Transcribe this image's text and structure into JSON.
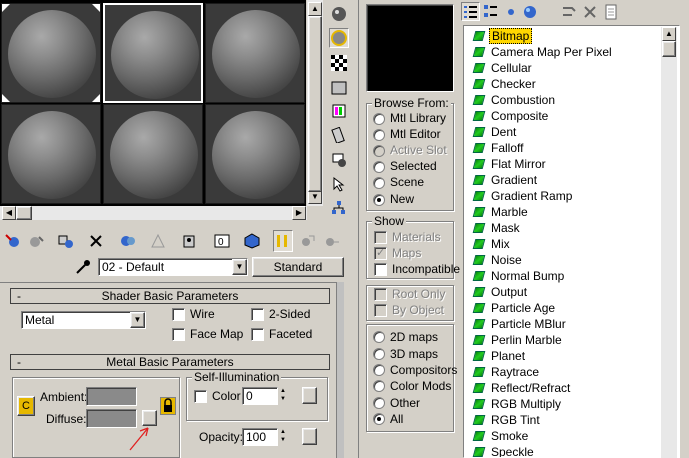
{
  "window": {
    "material_name": "02 - Default",
    "material_type": "Standard"
  },
  "shader_basic": {
    "header": "Shader Basic Parameters",
    "shader_value": "Metal",
    "wire_label": "Wire",
    "two_sided_label": "2-Sided",
    "face_map_label": "Face Map",
    "faceted_label": "Faceted"
  },
  "metal_basic": {
    "header": "Metal Basic Parameters",
    "ambient_label": "Ambient:",
    "diffuse_label": "Diffuse:",
    "self_illum_title": "Self-Illumination",
    "color_label": "Color",
    "color_value": "0",
    "opacity_label": "Opacity:",
    "opacity_value": "100",
    "lock_label": "C"
  },
  "browse_from": {
    "title": "Browse From:",
    "options": [
      {
        "label": "Mtl Library",
        "selected": false,
        "disabled": false
      },
      {
        "label": "Mtl Editor",
        "selected": false,
        "disabled": false
      },
      {
        "label": "Active Slot",
        "selected": false,
        "disabled": true
      },
      {
        "label": "Selected",
        "selected": false,
        "disabled": false
      },
      {
        "label": "Scene",
        "selected": false,
        "disabled": false
      },
      {
        "label": "New",
        "selected": true,
        "disabled": false
      }
    ]
  },
  "show": {
    "title": "Show",
    "options": [
      {
        "label": "Materials",
        "checked": false,
        "disabled": true
      },
      {
        "label": "Maps",
        "checked": true,
        "disabled": true
      },
      {
        "label": "Incompatible",
        "checked": false,
        "disabled": false
      }
    ]
  },
  "root_options": [
    {
      "label": "Root Only",
      "disabled": true
    },
    {
      "label": "By Object",
      "disabled": true
    }
  ],
  "map_category": [
    {
      "label": "2D maps",
      "selected": false
    },
    {
      "label": "3D maps",
      "selected": false
    },
    {
      "label": "Compositors",
      "selected": false
    },
    {
      "label": "Color Mods",
      "selected": false
    },
    {
      "label": "Other",
      "selected": false
    },
    {
      "label": "All",
      "selected": true
    }
  ],
  "maps": [
    "Bitmap",
    "Camera Map Per Pixel",
    "Cellular",
    "Checker",
    "Combustion",
    "Composite",
    "Dent",
    "Falloff",
    "Flat Mirror",
    "Gradient",
    "Gradient Ramp",
    "Marble",
    "Mask",
    "Mix",
    "Noise",
    "Normal Bump",
    "Output",
    "Particle Age",
    "Particle MBlur",
    "Perlin Marble",
    "Planet",
    "Raytrace",
    "Reflect/Refract",
    "RGB Multiply",
    "RGB Tint",
    "Smoke",
    "Speckle"
  ],
  "selected_map": "Bitmap",
  "colors": {
    "window_bg": "#d4d0c8",
    "selection": "#ffd700",
    "map_icon": "#22cc22",
    "annotation_arrow": "#e02020"
  }
}
